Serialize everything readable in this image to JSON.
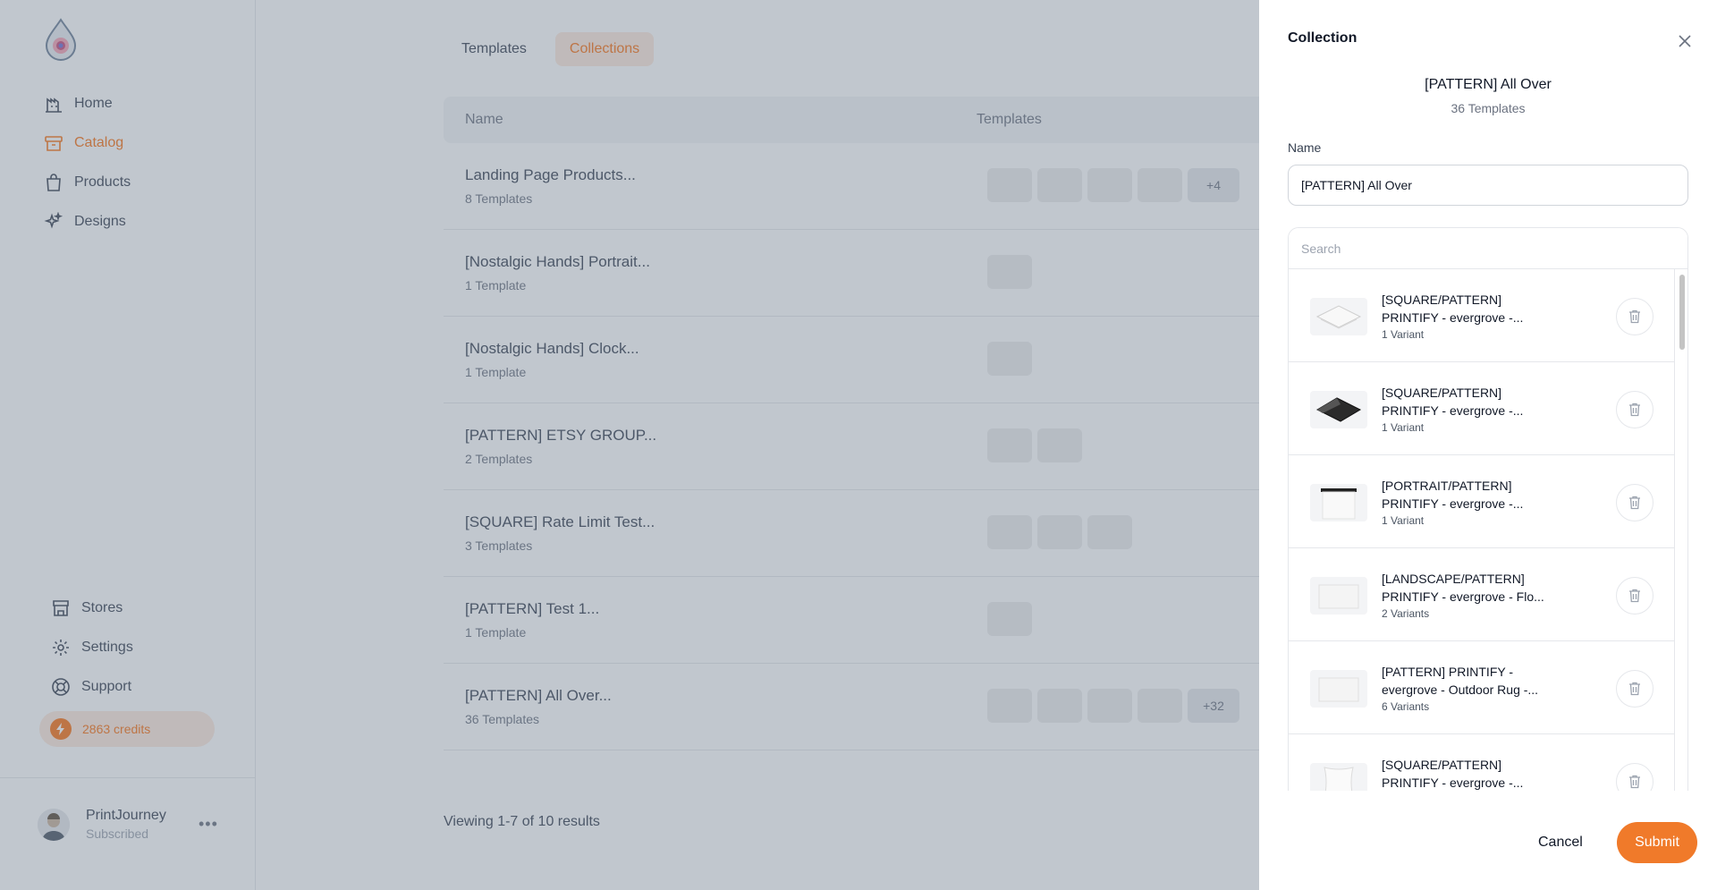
{
  "app": {
    "nav": [
      {
        "label": "Home",
        "icon": "home-icon",
        "active": false
      },
      {
        "label": "Catalog",
        "icon": "box-icon",
        "active": true
      },
      {
        "label": "Products",
        "icon": "bag-icon",
        "active": false
      },
      {
        "label": "Designs",
        "icon": "sparkle-icon",
        "active": false
      }
    ],
    "nav_bottom": [
      {
        "label": "Stores",
        "icon": "store-icon"
      },
      {
        "label": "Settings",
        "icon": "gear-icon"
      },
      {
        "label": "Support",
        "icon": "lifebuoy-icon"
      }
    ],
    "credits": "2863 credits",
    "user": {
      "name": "PrintJourney",
      "status": "Subscribed",
      "more": "•••"
    },
    "tabs": [
      {
        "label": "Templates",
        "active": false
      },
      {
        "label": "Collections",
        "active": true
      }
    ],
    "table": {
      "headers": [
        "Name",
        "Templates"
      ],
      "rows": [
        {
          "title": "Landing Page Products...",
          "sub": "8 Templates",
          "thumbs": 4,
          "more": "+4"
        },
        {
          "title": "[Nostalgic Hands] Portrait...",
          "sub": "1 Template",
          "thumbs": 1,
          "more": ""
        },
        {
          "title": "[Nostalgic Hands] Clock...",
          "sub": "1 Template",
          "thumbs": 1,
          "more": ""
        },
        {
          "title": "[PATTERN] ETSY GROUP...",
          "sub": "2 Templates",
          "thumbs": 2,
          "more": ""
        },
        {
          "title": "[SQUARE] Rate Limit Test...",
          "sub": "3 Templates",
          "thumbs": 3,
          "more": ""
        },
        {
          "title": "[PATTERN] Test 1...",
          "sub": "1 Template",
          "thumbs": 1,
          "more": ""
        },
        {
          "title": "[PATTERN] All Over...",
          "sub": "36 Templates",
          "thumbs": 4,
          "more": "+32"
        }
      ]
    },
    "viewing": "Viewing 1-7 of 10 results"
  },
  "drawer": {
    "title": "Collection",
    "collection_name": "[PATTERN] All Over",
    "collection_count": "36 Templates",
    "name_label": "Name",
    "name_value": "[PATTERN] All Over",
    "search_placeholder": "Search",
    "items": [
      {
        "line1": "[SQUARE/PATTERN]",
        "line2": "PRINTIFY - evergrove -...",
        "sub": "1 Variant",
        "thumb": "blanket-white"
      },
      {
        "line1": "[SQUARE/PATTERN]",
        "line2": "PRINTIFY - evergrove -...",
        "sub": "1 Variant",
        "thumb": "blanket-dark"
      },
      {
        "line1": "[PORTRAIT/PATTERN]",
        "line2": "PRINTIFY - evergrove -...",
        "sub": "1 Variant",
        "thumb": "curtain"
      },
      {
        "line1": "[LANDSCAPE/PATTERN]",
        "line2": "PRINTIFY - evergrove - Flo...",
        "sub": "2 Variants",
        "thumb": "rug"
      },
      {
        "line1": "[PATTERN] PRINTIFY -",
        "line2": "evergrove - Outdoor Rug -...",
        "sub": "6 Variants",
        "thumb": "rug"
      },
      {
        "line1": "[SQUARE/PATTERN]",
        "line2": "PRINTIFY - evergrove -...",
        "sub": "",
        "thumb": "pillow"
      }
    ],
    "cancel_label": "Cancel",
    "submit_label": "Submit"
  },
  "colors": {
    "accent": "#f07a2a",
    "accent_soft": "#fde8dc",
    "overlay": "#6b7a8a"
  }
}
